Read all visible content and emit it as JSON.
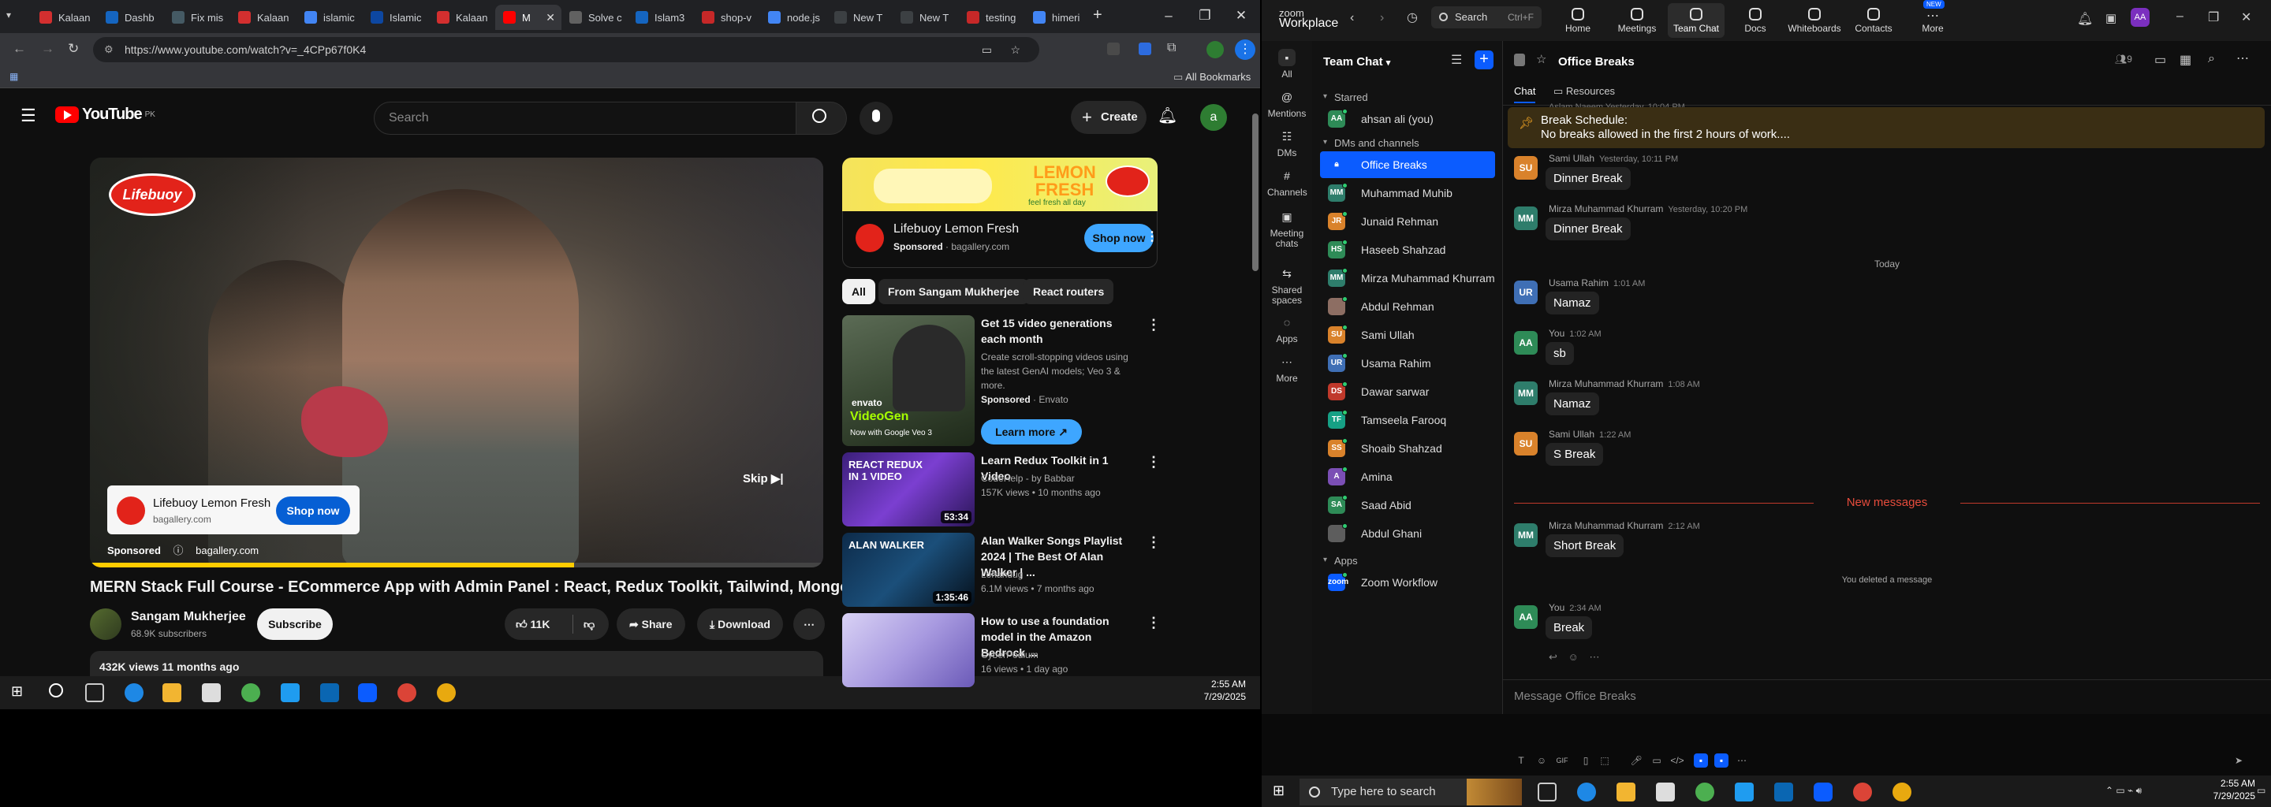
{
  "browser": {
    "tabs": [
      {
        "label": "Kalaan",
        "fav": "#d32f2f"
      },
      {
        "label": "Dashb",
        "fav": "#1565c0"
      },
      {
        "label": "Fix mis",
        "fav": "#455a64"
      },
      {
        "label": "Kalaan",
        "fav": "#d32f2f"
      },
      {
        "label": "islamic",
        "fav": "#4285f4"
      },
      {
        "label": "Islamic",
        "fav": "#0d47a1"
      },
      {
        "label": "Kalaan",
        "fav": "#d32f2f"
      },
      {
        "label": "M",
        "fav": "#ff0000"
      },
      {
        "label": "Solve c",
        "fav": "#616161"
      },
      {
        "label": "Islam3",
        "fav": "#1565c0"
      },
      {
        "label": "shop-v",
        "fav": "#c62828"
      },
      {
        "label": "node.js",
        "fav": "#4285f4"
      },
      {
        "label": "New T",
        "fav": "#3c4043"
      },
      {
        "label": "New T",
        "fav": "#3c4043"
      },
      {
        "label": "testing",
        "fav": "#c62828"
      },
      {
        "label": "himeri",
        "fav": "#4285f4"
      }
    ],
    "url": "https://www.youtube.com/watch?v=_4CPp67f0K4",
    "all_bookmarks": "All Bookmarks"
  },
  "youtube": {
    "country": "PK",
    "search_placeholder": "Search",
    "create_label": "Create",
    "avatar_letter": "a",
    "player": {
      "ad_logo": "Lifebuoy",
      "ad_card_title": "Lifebuoy Lemon Fresh",
      "ad_card_domain": "bagallery.com",
      "ad_card_button": "Shop now",
      "sponsored": "Sponsored",
      "sponsored_domain": "bagallery.com",
      "skip": "Skip",
      "progress": 0.66
    },
    "title": "MERN Stack Full Course - ECommerce App with Admin Panel : React, Redux Toolkit, Tailwind, MongoDB",
    "channel": "Sangam Mukherjee",
    "subscribers": "68.9K subscribers",
    "subscribe": "Subscribe",
    "likes": "11K",
    "share": "Share",
    "download": "Download",
    "views_line": "432K views  11 months ago",
    "side_ad": {
      "banner_brand": "LEMON FRESH",
      "banner_sub": "feel fresh all day",
      "title": "Lifebuoy Lemon Fresh",
      "sponsored": "Sponsored",
      "domain": "bagallery.com",
      "button": "Shop now"
    },
    "chips": [
      "All",
      "From Sangam Mukherjee",
      "React routers"
    ],
    "recs": [
      {
        "title": "Get 15 video generations each month",
        "desc": "Create scroll-stopping videos using the latest GenAI models; Veo 3 & more.",
        "sponsor": "Sponsored",
        "sponsor_by": "Envato",
        "cta": "Learn more",
        "thumb_top": "envato",
        "thumb_mid": "VideoGen",
        "thumb_sub": "Now with Google Veo 3"
      },
      {
        "title": "Learn Redux Toolkit in 1 Video",
        "channel": "CodeHelp - by Babbar",
        "stats": "157K views • 10 months ago",
        "duration": "53:34",
        "thumb_text": "REACT REDUX IN 1 VIDEO"
      },
      {
        "title": "Alan Walker Songs Playlist 2024 | The Best Of Alan Walker | ...",
        "channel": "Lohandug",
        "stats": "6.1M views • 7 months ago",
        "duration": "1:35:46",
        "thumb_text": "ALAN WALKER"
      },
      {
        "title": "How to use a foundation model in the Amazon Bedrock ...",
        "channel": "CyberPodium",
        "stats": "16 views • 1 day ago",
        "duration": "",
        "thumb_text": ""
      }
    ]
  },
  "taskbar_left": {
    "time": "2:55 AM",
    "date": "7/29/2025"
  },
  "zoom": {
    "logo_top": "zoom",
    "logo_bottom": "Workplace",
    "search": "Search",
    "search_shortcut": "Ctrl+F",
    "nav": [
      {
        "label": "Home",
        "icon": "home-icon"
      },
      {
        "label": "Meetings",
        "icon": "meetings-icon"
      },
      {
        "label": "Team Chat",
        "icon": "team-chat-icon"
      },
      {
        "label": "Docs",
        "icon": "docs-icon"
      },
      {
        "label": "Whiteboards",
        "icon": "whiteboards-icon"
      },
      {
        "label": "Contacts",
        "icon": "contacts-icon"
      },
      {
        "label": "More",
        "icon": "more-icon"
      }
    ],
    "nav_new_badge": "NEW",
    "profile": "AA",
    "rail": [
      {
        "label": "All"
      },
      {
        "label": "Mentions"
      },
      {
        "label": "DMs"
      },
      {
        "label": "Channels"
      },
      {
        "label": "Meeting chats"
      },
      {
        "label": "Shared spaces"
      },
      {
        "label": "Apps"
      },
      {
        "label": "More"
      }
    ],
    "sidebar_title": "Team Chat",
    "section_starred": "Starred",
    "starred_item": {
      "name": "ahsan ali (you)",
      "initials": "AA",
      "color": "#2e8b57"
    },
    "section_dms": "DMs and channels",
    "dms": [
      {
        "name": "Office Breaks",
        "initials": "",
        "color": "#0b5cff",
        "active": true
      },
      {
        "name": "Muhammad Muhib",
        "initials": "MM",
        "color": "#2e7d6b"
      },
      {
        "name": "Junaid Rehman",
        "initials": "JR",
        "color": "#d9822b"
      },
      {
        "name": "Haseeb Shahzad",
        "initials": "HS",
        "color": "#2e8b57"
      },
      {
        "name": "Mirza Muhammad Khurram",
        "initials": "MM",
        "color": "#2e7d6b"
      },
      {
        "name": "Abdul Rehman",
        "initials": "",
        "color": "#8d6e63"
      },
      {
        "name": "Sami Ullah",
        "initials": "SU",
        "color": "#d9822b"
      },
      {
        "name": "Usama Rahim",
        "initials": "UR",
        "color": "#3f6fb5"
      },
      {
        "name": "Dawar sarwar",
        "initials": "DS",
        "color": "#c0392b"
      },
      {
        "name": "Tamseela Farooq",
        "initials": "TF",
        "color": "#16a085"
      },
      {
        "name": "Shoaib Shahzad",
        "initials": "SS",
        "color": "#d9822b"
      },
      {
        "name": "Amina",
        "initials": "A",
        "color": "#7b4fb5"
      },
      {
        "name": "Saad Abid",
        "initials": "SA",
        "color": "#2e8b57"
      },
      {
        "name": "Abdul Ghani",
        "initials": "",
        "color": "#5d5d5d"
      }
    ],
    "section_apps": "Apps",
    "app_item": {
      "name": "Zoom Workflow",
      "initials": "zoom",
      "color": "#0b5cff"
    },
    "channel_title": "Office Breaks",
    "tab_chat": "Chat",
    "tab_resources": "Resources",
    "member_count": "9",
    "pinned_title": "Break Schedule:",
    "pinned_body": "No breaks allowed in the first 2 hours of work....",
    "partial_header": "Aslam Naeem  Yesterday, 10:04 PM",
    "messages": [
      {
        "author": "Sami Ullah",
        "time": "Yesterday, 10:11 PM",
        "text": "Dinner Break",
        "initials": "SU",
        "color": "#d9822b"
      },
      {
        "author": "Mirza Muhammad Khurram",
        "time": "Yesterday, 10:20 PM",
        "text": "Dinner Break",
        "initials": "MM",
        "color": "#2e7d6b"
      },
      {
        "author": "Usama Rahim",
        "time": "1:01 AM",
        "text": "Namaz",
        "initials": "UR",
        "color": "#3f6fb5"
      },
      {
        "author": "You",
        "time": "1:02 AM",
        "text": "sb",
        "initials": "AA",
        "color": "#2e8b57"
      },
      {
        "author": "Mirza Muhammad Khurram",
        "time": "1:08 AM",
        "text": "Namaz",
        "initials": "MM",
        "color": "#2e7d6b"
      },
      {
        "author": "Sami Ullah",
        "time": "1:22 AM",
        "text": "S Break",
        "initials": "SU",
        "color": "#d9822b"
      },
      {
        "author": "Mirza Muhammad Khurram",
        "time": "2:12 AM",
        "text": "Short Break",
        "initials": "MM",
        "color": "#2e7d6b"
      },
      {
        "author": "You",
        "time": "2:34 AM",
        "text": "Break",
        "initials": "AA",
        "color": "#2e8b57"
      }
    ],
    "today_label": "Today",
    "new_messages": "New messages",
    "deleted_notice": "You deleted a message",
    "composer_placeholder": "Message Office Breaks"
  },
  "taskbar_right": {
    "search_placeholder": "Type here to search",
    "time": "2:55 AM",
    "date": "7/29/2025"
  }
}
